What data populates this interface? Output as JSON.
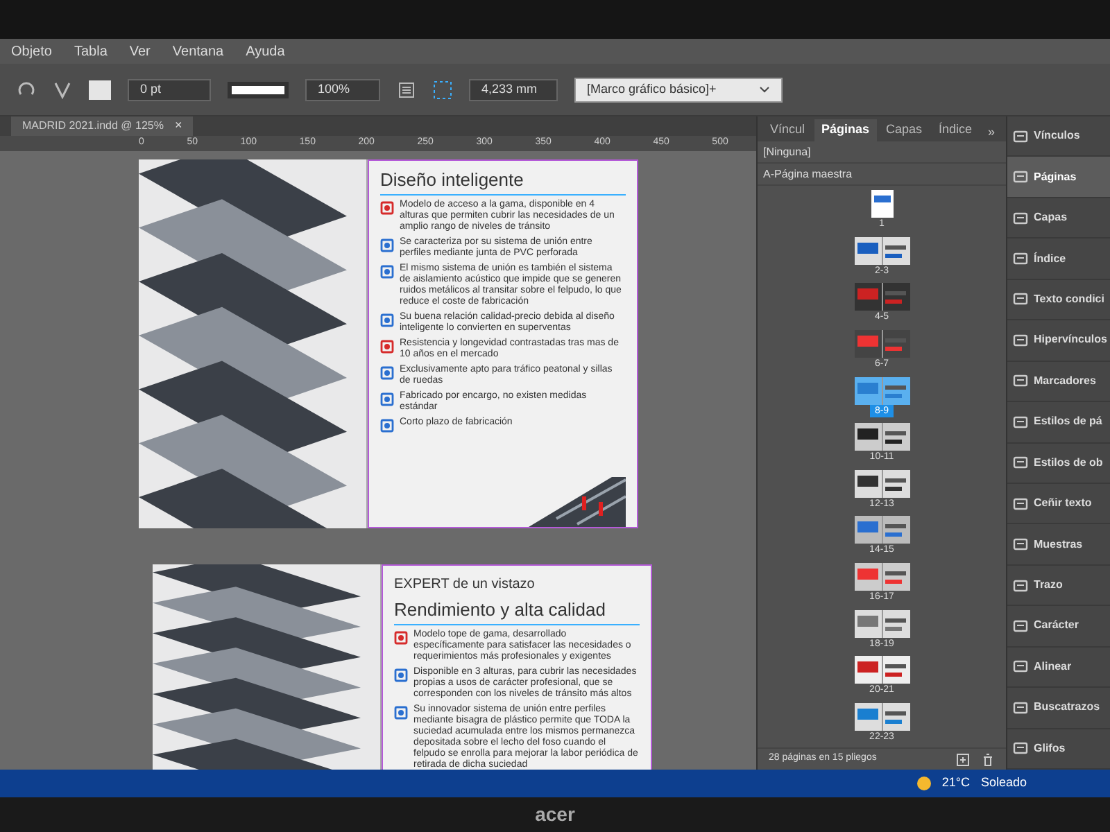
{
  "menu": [
    "Objeto",
    "Tabla",
    "Ver",
    "Ventana",
    "Ayuda"
  ],
  "control_bar": {
    "stroke_weight": "0 pt",
    "scale": "100%",
    "offset": "4,233 mm",
    "object_style": "[Marco gráfico básico]+"
  },
  "document_tab": {
    "title": "MADRID 2021.indd @ 125%",
    "close": "×"
  },
  "ruler": {
    "ticks": [
      "0",
      "50",
      "100",
      "150",
      "200",
      "250",
      "300",
      "350",
      "400",
      "450",
      "500"
    ]
  },
  "spreads": [
    {
      "heading": "Diseño inteligente",
      "features": [
        "Modelo de acceso a la gama, disponible en 4 alturas que permiten cubrir las necesidades de un amplio rango de niveles de tránsito",
        "Se caracteriza por su sistema de unión entre perfiles mediante junta de PVC perforada",
        "El mismo sistema de unión es también el sistema de aislamiento acústico que impide que se generen ruidos metálicos al transitar sobre el felpudo, lo que reduce el coste de fabricación",
        "Su buena relación calidad-precio debida al diseño inteligente lo convierten en superventas",
        "Resistencia y longevidad contrastadas tras mas de 10 años en el mercado",
        "Exclusivamente apto para tráfico peatonal y sillas de ruedas",
        "Fabricado por encargo, no existen medidas estándar",
        "Corto plazo de fabricación"
      ]
    },
    {
      "kicker": "EXPERT de un vistazo",
      "heading": "Rendimiento y alta calidad",
      "features": [
        "Modelo tope de gama, desarrollado específicamente para satisfacer las necesidades o requerimientos más profesionales y exigentes",
        "Disponible en 3 alturas, para cubrir las necesidades propias a usos de carácter profesional, que se corresponden con los niveles de tránsito más altos",
        "Su innovador sistema de unión entre perfiles mediante bisagra de plástico permite que TODA la suciedad acumulada entre los mismos permanezca depositada sobre el lecho del foso cuando el felpudo se enrolla para mejorar la labor periódica de retirada de dicha suciedad"
      ]
    }
  ],
  "pages_panel": {
    "tabs": [
      {
        "label": "Víncul",
        "selected": false
      },
      {
        "label": "Páginas",
        "selected": true
      },
      {
        "label": "Capas",
        "selected": false
      },
      {
        "label": "Índice",
        "selected": false
      }
    ],
    "more": "»",
    "masters": [
      "[Ninguna]",
      "A-Página maestra"
    ],
    "pages": [
      {
        "label": "1",
        "selected": false
      },
      {
        "label": "2-3",
        "selected": false
      },
      {
        "label": "4-5",
        "selected": false
      },
      {
        "label": "6-7",
        "selected": false
      },
      {
        "label": "8-9",
        "selected": true
      },
      {
        "label": "10-11",
        "selected": false
      },
      {
        "label": "12-13",
        "selected": false
      },
      {
        "label": "14-15",
        "selected": false
      },
      {
        "label": "16-17",
        "selected": false
      },
      {
        "label": "18-19",
        "selected": false
      },
      {
        "label": "20-21",
        "selected": false
      },
      {
        "label": "22-23",
        "selected": false
      }
    ],
    "footer": "28 páginas en 15 pliegos"
  },
  "dock": [
    {
      "label": "Vínculos",
      "selected": false
    },
    {
      "label": "Páginas",
      "selected": true
    },
    {
      "label": "Capas",
      "selected": false
    },
    {
      "label": "Índice",
      "selected": false
    },
    {
      "label": "Texto condici",
      "selected": false
    },
    {
      "label": "Hipervínculos",
      "selected": false
    },
    {
      "label": "Marcadores",
      "selected": false
    },
    {
      "label": "Estilos de pá",
      "selected": false
    },
    {
      "label": "Estilos de ob",
      "selected": false
    },
    {
      "label": "Ceñir texto",
      "selected": false
    },
    {
      "label": "Muestras",
      "selected": false
    },
    {
      "label": "Trazo",
      "selected": false
    },
    {
      "label": "Carácter",
      "selected": false
    },
    {
      "label": "Alinear",
      "selected": false
    },
    {
      "label": "Buscatrazos",
      "selected": false
    },
    {
      "label": "Glifos",
      "selected": false
    }
  ],
  "taskbar": {
    "temperature": "21°C",
    "weather": "Soleado"
  },
  "monitor": {
    "brand": "acer"
  }
}
